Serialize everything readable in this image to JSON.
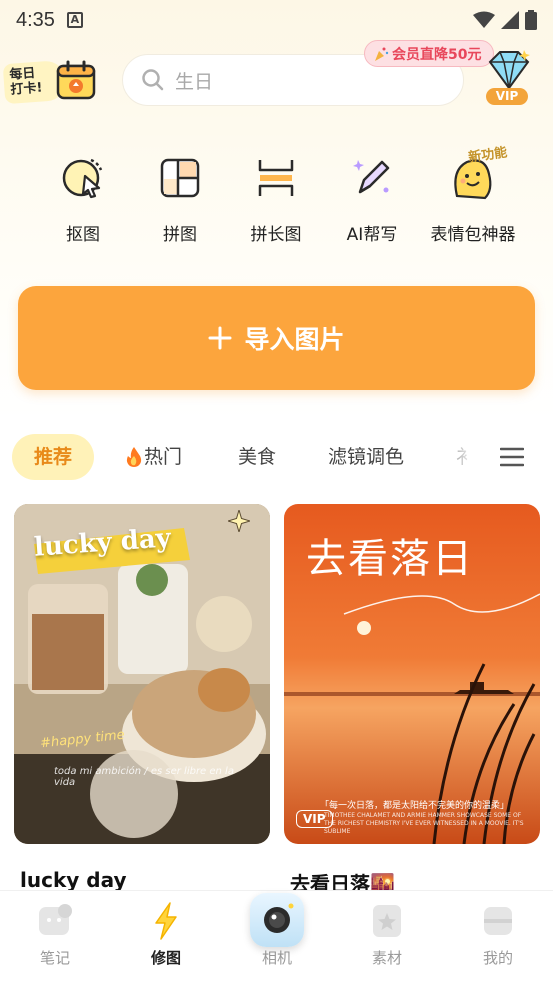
{
  "status_bar": {
    "time": "4:35",
    "notification_letter": "A"
  },
  "header": {
    "checkin_label": "每日\n打卡!",
    "search_placeholder": "生日",
    "promo_text": "会员直降50元",
    "vip_label": "VIP"
  },
  "tools": [
    {
      "label": "抠图",
      "icon": "cutout-icon"
    },
    {
      "label": "拼图",
      "icon": "collage-icon"
    },
    {
      "label": "拼长图",
      "icon": "long-image-icon"
    },
    {
      "label": "AI帮写",
      "icon": "ai-pen-icon"
    },
    {
      "label": "表情包神器",
      "icon": "emoji-maker-icon",
      "tag": "新功能"
    }
  ],
  "import_button": {
    "label": "导入图片"
  },
  "categories": [
    {
      "label": "推荐",
      "active": true
    },
    {
      "label": "热门",
      "prefix_icon": "fire-icon"
    },
    {
      "label": "美食"
    },
    {
      "label": "滤镜调色"
    },
    {
      "label": "衤"
    }
  ],
  "cards": [
    {
      "title": "lucky day",
      "image_overlay_title": "lucky day",
      "image_overlay_tag": "#happy time",
      "image_overlay_text": "toda mi ambición / es ser libre en la vida"
    },
    {
      "title": "去看日落🌇",
      "image_overlay_title": "去看落日",
      "image_caption": "「每一次日落，都是太阳给不完美的你的温柔」",
      "image_small_text": "TIMOTHEE CHALAMET AND ARMIE HAMMER SHOWCASE SOME OF THE RICHEST CHEMISTRY I'VE EVER WITNESSED IN A MOOVIE. IT'S SUBLIME",
      "vip_label": "VIP"
    }
  ],
  "bottom_nav": [
    {
      "label": "笔记",
      "icon": "note-icon",
      "active": false
    },
    {
      "label": "修图",
      "icon": "lightning-icon",
      "active": true
    },
    {
      "label": "相机",
      "icon": "camera-icon",
      "active": false
    },
    {
      "label": "素材",
      "icon": "star-icon",
      "active": false
    },
    {
      "label": "我的",
      "icon": "profile-icon",
      "active": false
    }
  ],
  "colors": {
    "accent": "#fca53d",
    "active_tab_bg": "#fff2b8",
    "active_tab_text": "#e88a1a",
    "promo_text": "#e8475b"
  }
}
